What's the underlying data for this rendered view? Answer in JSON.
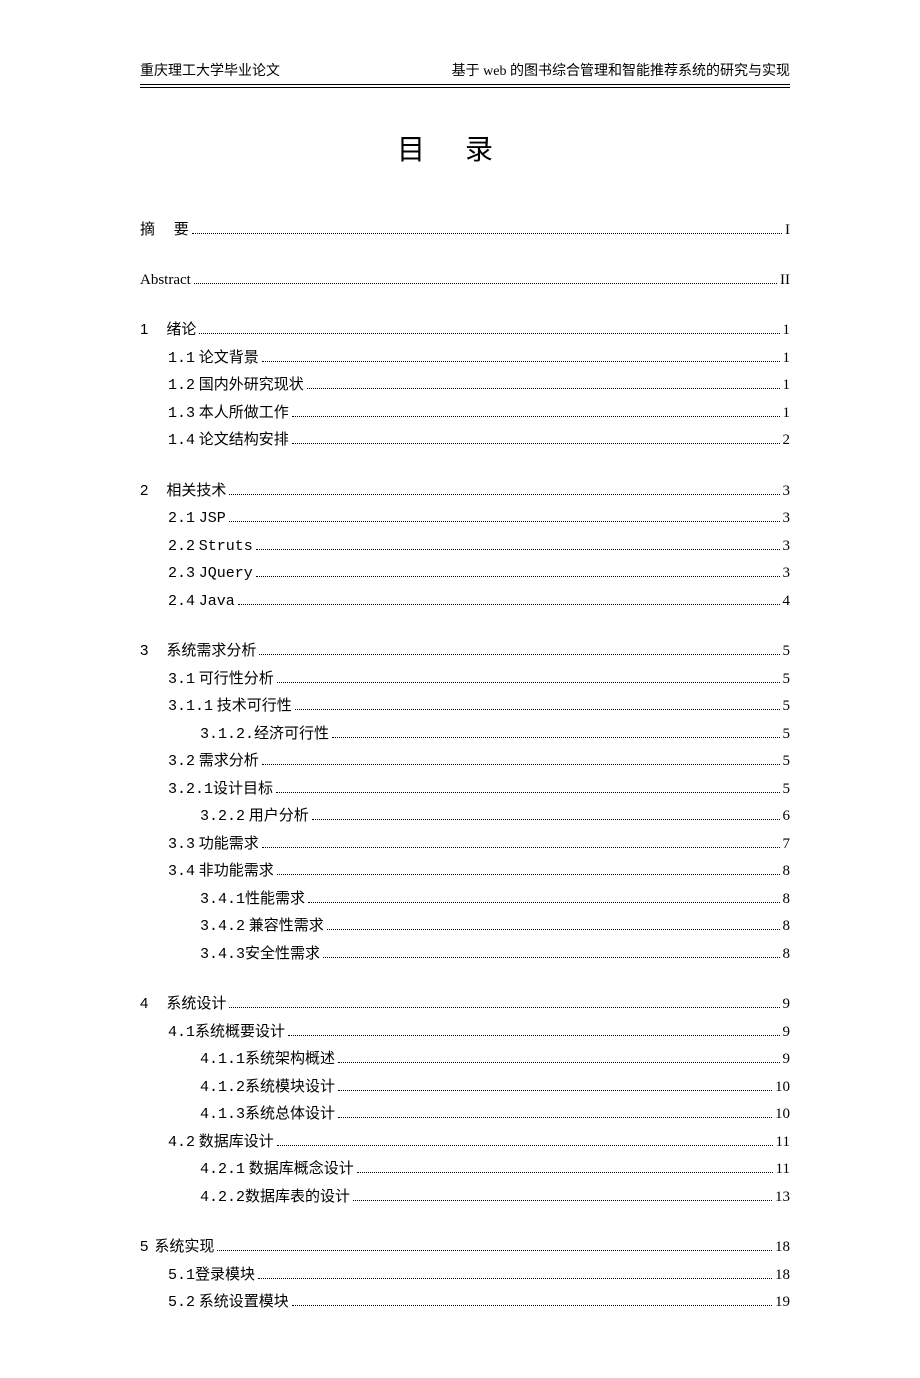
{
  "header": {
    "left": "重庆理工大学毕业论文",
    "right": "基于 web 的图书综合管理和智能推荐系统的研究与实现"
  },
  "title": "目录",
  "toc": {
    "abstract_cn_label": "摘",
    "abstract_cn_label2": "要",
    "abstract_cn_page": "I",
    "abstract_en_label": "Abstract",
    "abstract_en_page": "II",
    "ch1_num": "1",
    "ch1_label": "绪论",
    "ch1_page": "1",
    "s1_1_num": "1.1",
    "s1_1_label": "论文背景",
    "s1_1_page": "1",
    "s1_2_num": "1.2",
    "s1_2_label": "国内外研究现状",
    "s1_2_page": "1",
    "s1_3_num": "1.3",
    "s1_3_label": "本人所做工作",
    "s1_3_page": "1",
    "s1_4_num": "1.4",
    "s1_4_label": "论文结构安排",
    "s1_4_page": "2",
    "ch2_num": "2",
    "ch2_label": "相关技术",
    "ch2_page": "3",
    "s2_1_num": "2.1",
    "s2_1_label": "JSP",
    "s2_1_page": "3",
    "s2_2_num": "2.2",
    "s2_2_label": "Struts",
    "s2_2_page": "3",
    "s2_3_num": "2.3",
    "s2_3_label": "JQuery",
    "s2_3_page": "3",
    "s2_4_num": "2.4",
    "s2_4_label": "Java",
    "s2_4_page": "4",
    "ch3_num": "3",
    "ch3_label": "系统需求分析",
    "ch3_page": "5",
    "s3_1_num": "3.1",
    "s3_1_label": "可行性分析",
    "s3_1_page": "5",
    "s3_1_1_num": "3.1.1",
    "s3_1_1_label": "技术可行性",
    "s3_1_1_page": "5",
    "s3_1_2_num": "3.1.2.",
    "s3_1_2_label": "经济可行性",
    "s3_1_2_page": "5",
    "s3_2_num": "3.2",
    "s3_2_label": "需求分析",
    "s3_2_page": "5",
    "s3_2_1_num": "3.2.1",
    "s3_2_1_label": "设计目标",
    "s3_2_1_page": "5",
    "s3_2_2_num": "3.2.2",
    "s3_2_2_label": "用户分析",
    "s3_2_2_page": "6",
    "s3_3_num": "3.3",
    "s3_3_label": "功能需求",
    "s3_3_page": "7",
    "s3_4_num": "3.4",
    "s3_4_label": "非功能需求",
    "s3_4_page": "8",
    "s3_4_1_num": "3.4.1",
    "s3_4_1_label": "性能需求",
    "s3_4_1_page": "8",
    "s3_4_2_num": "3.4.2",
    "s3_4_2_label": "兼容性需求",
    "s3_4_2_page": "8",
    "s3_4_3_num": "3.4.3",
    "s3_4_3_label": "安全性需求",
    "s3_4_3_page": "8",
    "ch4_num": "4",
    "ch4_label": "系统设计",
    "ch4_page": "9",
    "s4_1_num": "4.1",
    "s4_1_label": "系统概要设计",
    "s4_1_page": "9",
    "s4_1_1_num": "4.1.1",
    "s4_1_1_label": "系统架构概述",
    "s4_1_1_page": "9",
    "s4_1_2_num": "4.1.2",
    "s4_1_2_label": "系统模块设计",
    "s4_1_2_page": "10",
    "s4_1_3_num": "4.1.3",
    "s4_1_3_label": "系统总体设计",
    "s4_1_3_page": "10",
    "s4_2_num": "4.2",
    "s4_2_label": "数据库设计",
    "s4_2_page": "11",
    "s4_2_1_num": "4.2.1",
    "s4_2_1_label": "数据库概念设计",
    "s4_2_1_page": "11",
    "s4_2_2_num": "4.2.2",
    "s4_2_2_label": "数据库表的设计",
    "s4_2_2_page": "13",
    "ch5_num": "5",
    "ch5_label": "系统实现",
    "ch5_page": "18",
    "s5_1_num": "5.1",
    "s5_1_label": "登录模块",
    "s5_1_page": "18",
    "s5_2_num": "5.2",
    "s5_2_label": "系统设置模块",
    "s5_2_page": "19"
  }
}
